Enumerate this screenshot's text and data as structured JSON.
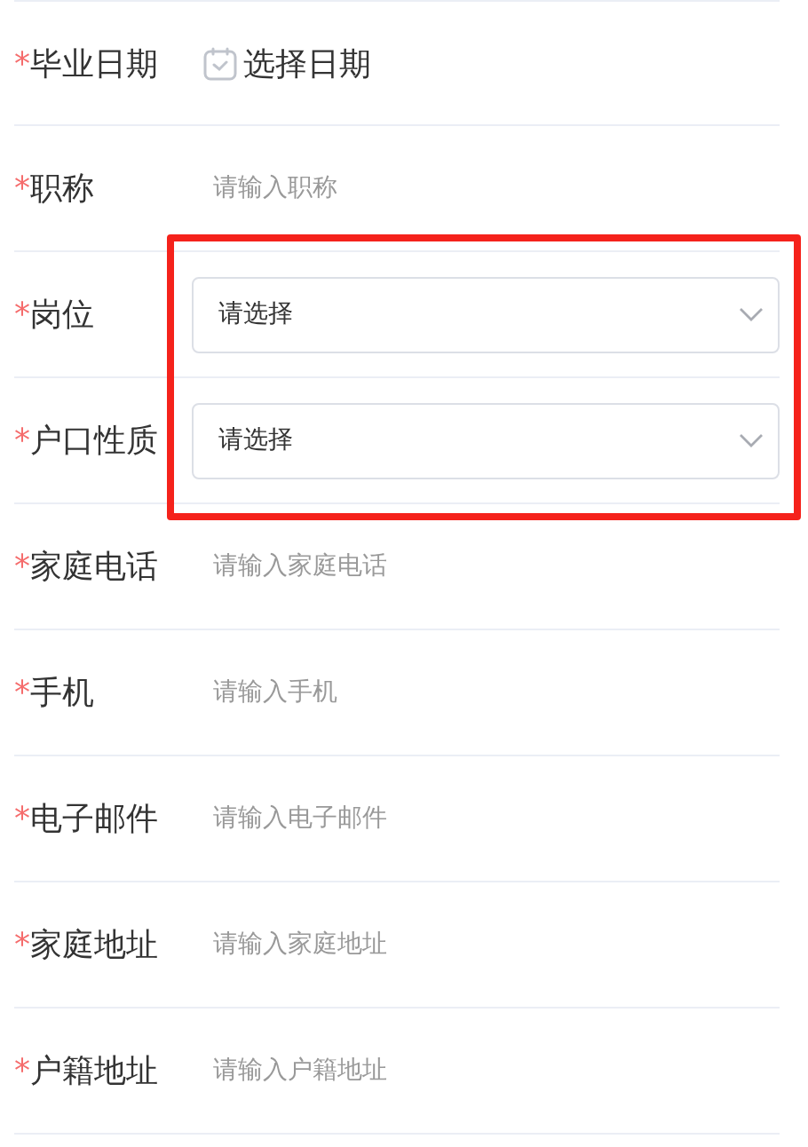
{
  "form": {
    "rows": [
      {
        "kind": "date",
        "required_mark": "*",
        "label": "毕业日期",
        "value": "选择日期"
      },
      {
        "kind": "input",
        "required_mark": "*",
        "label": "职称",
        "placeholder": "请输入职称"
      },
      {
        "kind": "select",
        "required_mark": "*",
        "label": "岗位",
        "placeholder": "请选择"
      },
      {
        "kind": "select",
        "required_mark": "*",
        "label": "户口性质",
        "placeholder": "请选择"
      },
      {
        "kind": "input",
        "required_mark": "*",
        "label": "家庭电话",
        "placeholder": "请输入家庭电话"
      },
      {
        "kind": "input",
        "required_mark": "*",
        "label": "手机",
        "placeholder": "请输入手机"
      },
      {
        "kind": "input",
        "required_mark": "*",
        "label": "电子邮件",
        "placeholder": "请输入电子邮件"
      },
      {
        "kind": "input",
        "required_mark": "*",
        "label": "家庭地址",
        "placeholder": "请输入家庭地址"
      },
      {
        "kind": "input",
        "required_mark": "*",
        "label": "户籍地址",
        "placeholder": "请输入户籍地址"
      }
    ]
  }
}
